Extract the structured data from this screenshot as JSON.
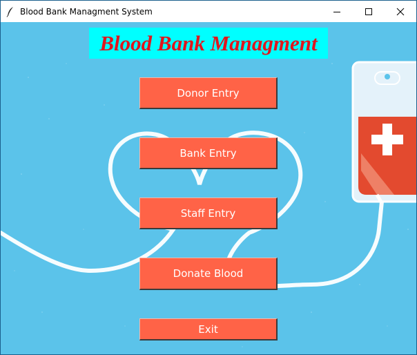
{
  "window": {
    "title": "Blood Bank Managment System",
    "controls": {
      "minimize_icon": "minimize-icon",
      "maximize_icon": "maximize-icon",
      "close_icon": "close-icon"
    }
  },
  "main": {
    "heading": "Blood Bank Managment",
    "buttons": [
      {
        "label": "Donor Entry"
      },
      {
        "label": "Bank Entry"
      },
      {
        "label": "Staff Entry"
      },
      {
        "label": "Donate Blood"
      },
      {
        "label": "Exit"
      }
    ]
  },
  "colors": {
    "background": "#5bc3ea",
    "heading_bg": "#00ffff",
    "heading_text": "#e0161d",
    "button_bg": "#ff6347",
    "button_text": "#ffffff"
  },
  "illustration": "blood-bag-heart-icon"
}
